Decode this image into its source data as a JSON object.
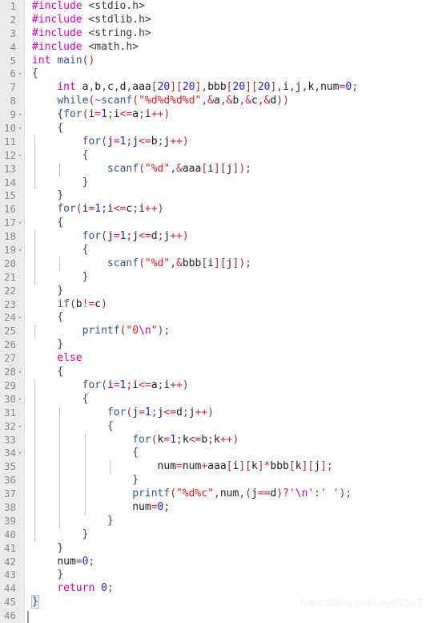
{
  "editor": {
    "language": "C",
    "total_lines": 46,
    "gutter_fold_glyph": "▾",
    "colors": {
      "background": "#ffffff",
      "gutter_background": "#ebebeb",
      "gutter_text": "#8a8a8a",
      "preprocessor": "#cc00cc",
      "keyword": "#cc00aa",
      "control": "#31578b",
      "string": "#e01b1b",
      "number": "#2222cc",
      "punctuation": "#9a2f2f",
      "operator": "#cc2255",
      "brace": "#5a3c2e",
      "indent_guide": "#c8c8c8",
      "brace_match_highlight": "#dff0ff"
    }
  },
  "watermark": {
    "text": "https://blog.csdn.net/SSnT"
  },
  "lines": [
    {
      "n": 1,
      "fold": false,
      "indent": 0,
      "guides": 0,
      "text": "#include <stdio.h>"
    },
    {
      "n": 2,
      "fold": false,
      "indent": 0,
      "guides": 0,
      "text": "#include <stdlib.h>"
    },
    {
      "n": 3,
      "fold": false,
      "indent": 0,
      "guides": 0,
      "text": "#include <string.h>"
    },
    {
      "n": 4,
      "fold": false,
      "indent": 0,
      "guides": 0,
      "text": "#include <math.h>"
    },
    {
      "n": 5,
      "fold": false,
      "indent": 0,
      "guides": 0,
      "text": "int main()"
    },
    {
      "n": 6,
      "fold": true,
      "indent": 0,
      "guides": 0,
      "text": "{"
    },
    {
      "n": 7,
      "fold": false,
      "indent": 1,
      "guides": 0,
      "text": "    int a,b,c,d,aaa[20][20],bbb[20][20],i,j,k,num=0;"
    },
    {
      "n": 8,
      "fold": false,
      "indent": 1,
      "guides": 0,
      "text": "    while(~scanf(\"%d%d%d%d\",&a,&b,&c,&d))"
    },
    {
      "n": 9,
      "fold": true,
      "indent": 1,
      "guides": 0,
      "text": "    {for(i=1;i<=a;i++)"
    },
    {
      "n": 10,
      "fold": true,
      "indent": 1,
      "guides": 0,
      "text": "    {"
    },
    {
      "n": 11,
      "fold": false,
      "indent": 2,
      "guides": 1,
      "text": "        for(j=1;j<=b;j++)"
    },
    {
      "n": 12,
      "fold": true,
      "indent": 2,
      "guides": 1,
      "text": "        {"
    },
    {
      "n": 13,
      "fold": false,
      "indent": 3,
      "guides": 2,
      "text": "            scanf(\"%d\",&aaa[i][j]);"
    },
    {
      "n": 14,
      "fold": false,
      "indent": 2,
      "guides": 1,
      "text": "        }"
    },
    {
      "n": 15,
      "fold": false,
      "indent": 1,
      "guides": 0,
      "text": "    }"
    },
    {
      "n": 16,
      "fold": false,
      "indent": 1,
      "guides": 0,
      "text": "    for(i=1;i<=c;i++)"
    },
    {
      "n": 17,
      "fold": true,
      "indent": 1,
      "guides": 0,
      "text": "    {"
    },
    {
      "n": 18,
      "fold": false,
      "indent": 2,
      "guides": 1,
      "text": "        for(j=1;j<=d;j++)"
    },
    {
      "n": 19,
      "fold": true,
      "indent": 2,
      "guides": 1,
      "text": "        {"
    },
    {
      "n": 20,
      "fold": false,
      "indent": 3,
      "guides": 2,
      "text": "            scanf(\"%d\",&bbb[i][j]);"
    },
    {
      "n": 21,
      "fold": false,
      "indent": 2,
      "guides": 1,
      "text": "        }"
    },
    {
      "n": 22,
      "fold": false,
      "indent": 1,
      "guides": 0,
      "text": "    }"
    },
    {
      "n": 23,
      "fold": false,
      "indent": 1,
      "guides": 0,
      "text": "    if(b!=c)"
    },
    {
      "n": 24,
      "fold": true,
      "indent": 1,
      "guides": 0,
      "text": "    {"
    },
    {
      "n": 25,
      "fold": false,
      "indent": 2,
      "guides": 1,
      "text": "        printf(\"0\\n\");"
    },
    {
      "n": 26,
      "fold": false,
      "indent": 1,
      "guides": 0,
      "text": "    }"
    },
    {
      "n": 27,
      "fold": false,
      "indent": 1,
      "guides": 0,
      "text": "    else"
    },
    {
      "n": 28,
      "fold": true,
      "indent": 1,
      "guides": 0,
      "text": "    {"
    },
    {
      "n": 29,
      "fold": false,
      "indent": 2,
      "guides": 1,
      "text": "        for(i=1;i<=a;i++)"
    },
    {
      "n": 30,
      "fold": true,
      "indent": 2,
      "guides": 1,
      "text": "        {"
    },
    {
      "n": 31,
      "fold": false,
      "indent": 3,
      "guides": 2,
      "text": "            for(j=1;j<=d;j++)"
    },
    {
      "n": 32,
      "fold": true,
      "indent": 3,
      "guides": 2,
      "text": "            {"
    },
    {
      "n": 33,
      "fold": false,
      "indent": 4,
      "guides": 3,
      "text": "                for(k=1;k<=b;k++)"
    },
    {
      "n": 34,
      "fold": true,
      "indent": 4,
      "guides": 3,
      "text": "                {"
    },
    {
      "n": 35,
      "fold": false,
      "indent": 5,
      "guides": 4,
      "text": "                    num=num+aaa[i][k]*bbb[k][j];"
    },
    {
      "n": 36,
      "fold": false,
      "indent": 4,
      "guides": 3,
      "text": "                }"
    },
    {
      "n": 37,
      "fold": false,
      "indent": 4,
      "guides": 3,
      "text": "                printf(\"%d%c\",num,(j==d)?'\\n':' ');"
    },
    {
      "n": 38,
      "fold": false,
      "indent": 4,
      "guides": 3,
      "text": "                num=0;"
    },
    {
      "n": 39,
      "fold": false,
      "indent": 3,
      "guides": 2,
      "text": "            }"
    },
    {
      "n": 40,
      "fold": false,
      "indent": 2,
      "guides": 1,
      "text": "        }"
    },
    {
      "n": 41,
      "fold": false,
      "indent": 1,
      "guides": 0,
      "text": "    }"
    },
    {
      "n": 42,
      "fold": false,
      "indent": 1,
      "guides": 0,
      "text": "    num=0;"
    },
    {
      "n": 43,
      "fold": false,
      "indent": 1,
      "guides": 0,
      "text": "    }"
    },
    {
      "n": 44,
      "fold": false,
      "indent": 1,
      "guides": 0,
      "text": "    return 0;"
    },
    {
      "n": 45,
      "fold": false,
      "indent": 0,
      "guides": 0,
      "text": "}"
    },
    {
      "n": 46,
      "fold": false,
      "indent": 0,
      "guides": 0,
      "text": ""
    }
  ]
}
